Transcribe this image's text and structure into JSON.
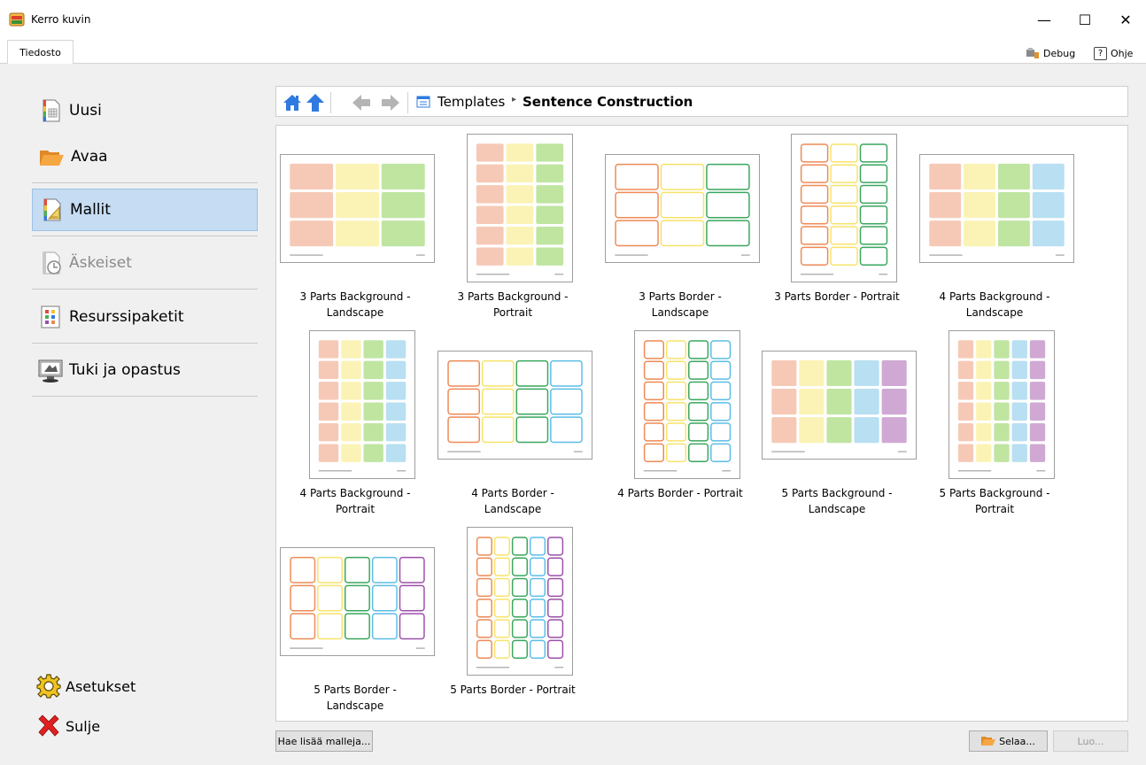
{
  "window": {
    "title": "Kerro kuvin",
    "minimize": "—",
    "maximize": "☐",
    "close": "✕"
  },
  "ribbon": {
    "file_tab": "Tiedosto",
    "debug": "Debug",
    "help": "Ohje",
    "help_glyph": "?"
  },
  "nav": {
    "items": [
      {
        "label": "Uusi",
        "icon": "new-document-icon",
        "state": "normal"
      },
      {
        "label": "Avaa",
        "icon": "open-folder-icon",
        "state": "normal"
      },
      {
        "label": "Mallit",
        "icon": "templates-icon",
        "state": "active"
      },
      {
        "label": "Äskeiset",
        "icon": "recent-icon",
        "state": "disabled"
      },
      {
        "label": "Resurssipaketit",
        "icon": "resource-packs-icon",
        "state": "normal"
      },
      {
        "label": "Tuki ja opastus",
        "icon": "support-icon",
        "state": "normal"
      }
    ],
    "settings": "Asetukset",
    "close": "Sulje"
  },
  "breadcrumb": {
    "root": "Templates",
    "separator": "▸",
    "current": "Sentence Construction"
  },
  "colors": {
    "orange_fill": "#f6c9b7",
    "yellow_fill": "#fbf3b5",
    "green_fill": "#bfe5a1",
    "blue_fill": "#b8dff2",
    "purple_fill": "#cfa9d3",
    "orange_line": "#ee8a55",
    "yellow_line": "#f7e36a",
    "green_line": "#3aa65e",
    "blue_line": "#5bbde6",
    "purple_line": "#9b4fa9",
    "active_nav": "#c5dcf2",
    "accent_blue": "#2f7ae0"
  },
  "templates": [
    {
      "label_line1": "3 Parts Background -",
      "label_line2": "Landscape",
      "parts": 3,
      "style": "background",
      "orientation": "landscape"
    },
    {
      "label_line1": "3 Parts Background -",
      "label_line2": "Portrait",
      "parts": 3,
      "style": "background",
      "orientation": "portrait"
    },
    {
      "label_line1": "3 Parts Border -",
      "label_line2": "Landscape",
      "parts": 3,
      "style": "border",
      "orientation": "landscape"
    },
    {
      "label_line1": "3 Parts Border - Portrait",
      "label_line2": "",
      "parts": 3,
      "style": "border",
      "orientation": "portrait"
    },
    {
      "label_line1": "4 Parts Background -",
      "label_line2": "Landscape",
      "parts": 4,
      "style": "background",
      "orientation": "landscape"
    },
    {
      "label_line1": "4 Parts Background -",
      "label_line2": "Portrait",
      "parts": 4,
      "style": "background",
      "orientation": "portrait"
    },
    {
      "label_line1": "4 Parts Border -",
      "label_line2": "Landscape",
      "parts": 4,
      "style": "border",
      "orientation": "landscape"
    },
    {
      "label_line1": "4 Parts Border - Portrait",
      "label_line2": "",
      "parts": 4,
      "style": "border",
      "orientation": "portrait"
    },
    {
      "label_line1": "5 Parts Background -",
      "label_line2": "Landscape",
      "parts": 5,
      "style": "background",
      "orientation": "landscape"
    },
    {
      "label_line1": "5 Parts Background -",
      "label_line2": "Portrait",
      "parts": 5,
      "style": "background",
      "orientation": "portrait"
    },
    {
      "label_line1": "5 Parts Border -",
      "label_line2": "Landscape",
      "parts": 5,
      "style": "border",
      "orientation": "landscape"
    },
    {
      "label_line1": "5 Parts Border - Portrait",
      "label_line2": "",
      "parts": 5,
      "style": "border",
      "orientation": "portrait"
    }
  ],
  "footer": {
    "get_more": "Hae lisää malleja...",
    "browse": "Selaa...",
    "create": "Luo..."
  }
}
